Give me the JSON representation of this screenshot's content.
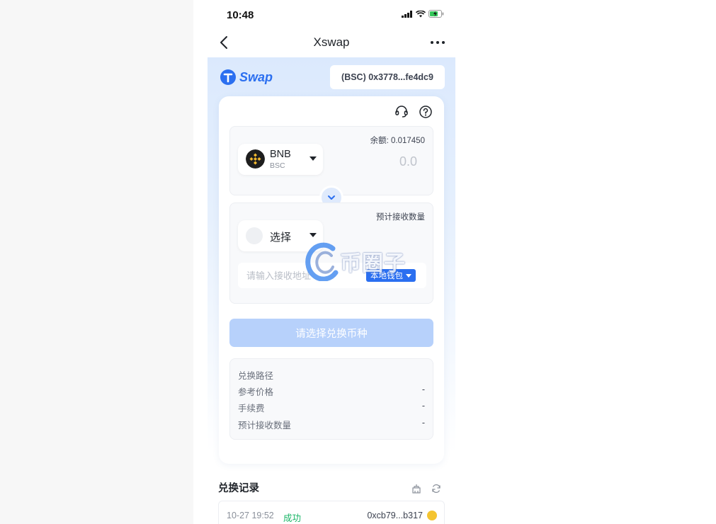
{
  "status_bar": {
    "time": "10:48"
  },
  "nav": {
    "title": "Xswap"
  },
  "swap": {
    "logo_text": "Swap",
    "wallet_address": "(BSC) 0x3778...fe4dc9",
    "from": {
      "balance_label": "余额: 0.017450",
      "token_name": "BNB",
      "token_chain": "BSC",
      "amount": "0.0"
    },
    "to": {
      "receive_label": "预计接收数量",
      "select_label": "选择",
      "address_placeholder": "请输入接收地址",
      "local_wallet_label": "本地钱包"
    },
    "submit_label": "请选择兑换币种",
    "info": [
      {
        "label": "兑换路径",
        "value": ""
      },
      {
        "label": "参考价格",
        "value": "-"
      },
      {
        "label": "手续费",
        "value": "-"
      },
      {
        "label": "预计接收数量",
        "value": "-"
      }
    ]
  },
  "history": {
    "title": "兑换记录",
    "rows": [
      {
        "time": "10-27 19:52",
        "status": "成功",
        "hash": "0xcb79...b317"
      }
    ]
  },
  "watermark": {
    "text": "币圈子"
  },
  "colors": {
    "accent": "#2b6ff0",
    "success": "#18b566",
    "bnb": "#f3ba2f"
  }
}
